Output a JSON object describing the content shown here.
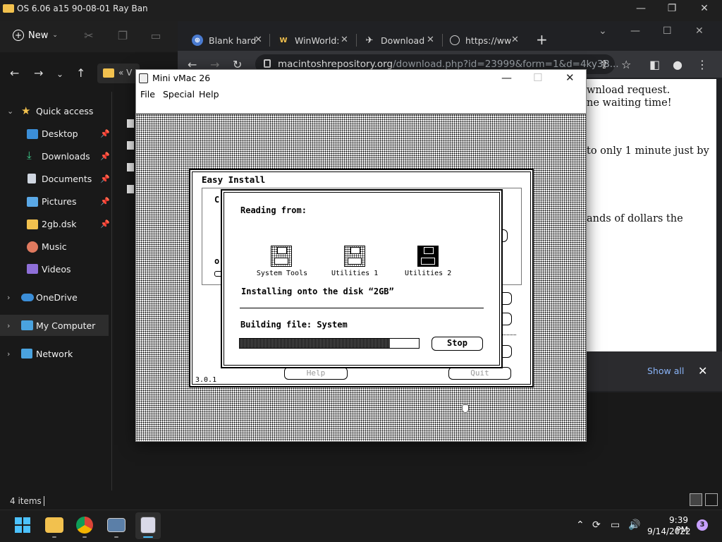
{
  "explorer": {
    "window_title": "OS 6.06 a15 90-08-01 Ray Ban",
    "new_label": "New",
    "address_fragment": "V",
    "nav": [
      {
        "label": "Quick access",
        "icon": "star-icon"
      },
      {
        "label": "Desktop",
        "icon": "desktop-icon"
      },
      {
        "label": "Downloads",
        "icon": "download-icon"
      },
      {
        "label": "Documents",
        "icon": "document-icon"
      },
      {
        "label": "Pictures",
        "icon": "pictures-icon"
      },
      {
        "label": "2gb.dsk",
        "icon": "folder-icon"
      },
      {
        "label": "Music",
        "icon": "music-icon"
      },
      {
        "label": "Videos",
        "icon": "videos-icon"
      },
      {
        "label": "OneDrive",
        "icon": "cloud-icon"
      },
      {
        "label": "My Computer",
        "icon": "computer-icon"
      },
      {
        "label": "Network",
        "icon": "network-icon"
      }
    ],
    "status": "4 items"
  },
  "chrome": {
    "tabs": [
      {
        "title": "Blank hard",
        "icon": "globe-icon"
      },
      {
        "title": "WinWorld:",
        "icon": "winworld-icon"
      },
      {
        "title": "Download",
        "icon": "apple-icon"
      },
      {
        "title": "https://ww",
        "icon": "globe-icon"
      }
    ],
    "url_main": "macintoshrepository.org",
    "url_rest": "/download.php?id=23999&form=1&d=4ky3B...",
    "page_lines": [
      "wnload request.",
      "ne waiting time!",
      "to only 1 minute just by",
      "ands of dollars the"
    ],
    "show_all": "Show all"
  },
  "vmac": {
    "title": "Mini vMac 26",
    "menus": [
      "File",
      "Special",
      "Help"
    ],
    "easy_install": {
      "title": "Easy Install",
      "frag_c": "C",
      "frag_o": "o",
      "help_label": "Help",
      "quit_label": "Quit",
      "version": "3.0.1"
    },
    "dialog": {
      "reading_from": "Reading from:",
      "disks": [
        "System Tools",
        "Utilities 1",
        "Utilities 2"
      ],
      "installing": "Installing onto the disk “2GB”",
      "building": "Building file: System",
      "progress": 0.84,
      "stop_label": "Stop"
    }
  },
  "taskbar": {
    "time": "9:39 PM",
    "date": "9/14/2022",
    "notifications": "3"
  }
}
